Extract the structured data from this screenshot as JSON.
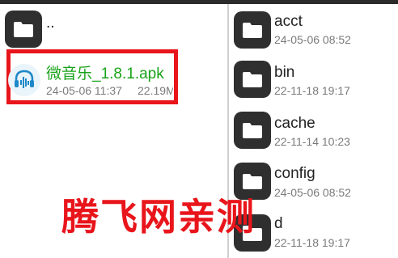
{
  "left_pane": {
    "parent_entry": {
      "name": "..",
      "icon": "folder-icon"
    },
    "files": [
      {
        "name": "微音乐_1.8.1.apk",
        "date": "24-05-06 11:37",
        "size": "22.19M",
        "icon": "music-app-icon"
      }
    ]
  },
  "right_pane": {
    "folders": [
      {
        "name": "acct",
        "date": "24-05-06 08:52",
        "icon": "folder-icon"
      },
      {
        "name": "bin",
        "date": "22-11-18 19:17",
        "icon": "folder-icon"
      },
      {
        "name": "cache",
        "date": "22-11-14 10:23",
        "icon": "folder-icon"
      },
      {
        "name": "config",
        "date": "24-05-06 08:52",
        "icon": "folder-icon"
      },
      {
        "name": "d",
        "date": "22-11-18 19:17",
        "icon": "folder-icon"
      }
    ]
  },
  "watermark": "腾飞网亲测",
  "colors": {
    "highlight": "#e8151b",
    "apk_name": "#1aa31a",
    "folder_tile": "#2f2f2f"
  }
}
